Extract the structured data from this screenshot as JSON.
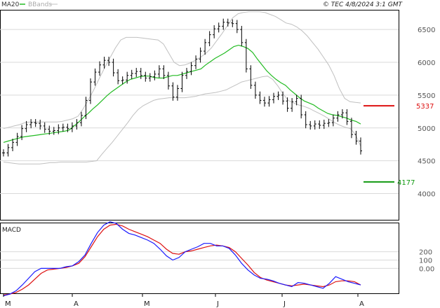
{
  "header": {
    "ma_label": "MA20",
    "bb_label": "BBands",
    "copyright": "© TEC 4/8/2024 3:1 GMT"
  },
  "colors": {
    "price": "#000000",
    "ma": "#22bb22",
    "bbands": "#c0c0c0",
    "macd": "#1a1aff",
    "signal": "#dd1111",
    "resistance": "#dd1111",
    "support": "#119911",
    "grid": "#d9d9d9"
  },
  "chart_data": [
    {
      "type": "candlestick",
      "name": "price",
      "title": "",
      "ylim": [
        3600,
        6800
      ],
      "y_ticks": [
        4000,
        4500,
        5000,
        5500,
        6000,
        6500
      ],
      "x_ticks": [
        "M",
        "A",
        "M",
        "J",
        "J",
        "A"
      ],
      "grid": true,
      "price": [
        4620,
        4700,
        4780,
        4870,
        4990,
        5050,
        5080,
        5070,
        5030,
        4980,
        4950,
        4960,
        5000,
        5010,
        4990,
        5030,
        5080,
        5190,
        5420,
        5700,
        5850,
        5960,
        6030,
        6000,
        5840,
        5720,
        5730,
        5800,
        5830,
        5860,
        5800,
        5760,
        5780,
        5820,
        5900,
        5800,
        5640,
        5470,
        5600,
        5800,
        5860,
        5950,
        6050,
        6170,
        6300,
        6420,
        6510,
        6550,
        6610,
        6600,
        6590,
        6500,
        6300,
        5900,
        5650,
        5500,
        5420,
        5380,
        5430,
        5480,
        5500,
        5410,
        5300,
        5400,
        5450,
        5200,
        5050,
        5030,
        5060,
        5040,
        5070,
        5080,
        5150,
        5200,
        5230,
        5100,
        4900,
        4800,
        4650
      ],
      "ma20": [
        4780,
        4800,
        4820,
        4840,
        4860,
        4870,
        4880,
        4890,
        4900,
        4910,
        4920,
        4930,
        4940,
        4950,
        4970,
        5030,
        5090,
        5160,
        5220,
        5290,
        5350,
        5420,
        5490,
        5550,
        5600,
        5650,
        5700,
        5740,
        5760,
        5780,
        5790,
        5790,
        5770,
        5760,
        5760,
        5780,
        5800,
        5800,
        5820,
        5840,
        5860,
        5880,
        5900,
        5960,
        6010,
        6060,
        6100,
        6140,
        6190,
        6240,
        6260,
        6240,
        6210,
        6150,
        6050,
        5960,
        5870,
        5800,
        5740,
        5690,
        5650,
        5580,
        5520,
        5460,
        5410,
        5380,
        5350,
        5300,
        5260,
        5220,
        5200,
        5190,
        5170,
        5150,
        5120,
        5100,
        5060
      ],
      "bb_upper": [
        4990,
        5010,
        5030,
        5050,
        5080,
        5090,
        5090,
        5090,
        5090,
        5090,
        5090,
        5100,
        5120,
        5140,
        5180,
        5300,
        5440,
        5590,
        5760,
        5920,
        6070,
        6220,
        6340,
        6380,
        6380,
        6380,
        6370,
        6360,
        6350,
        6340,
        6280,
        6140,
        6000,
        5950,
        5960,
        5990,
        6030,
        6080,
        6140,
        6220,
        6330,
        6440,
        6560,
        6680,
        6740,
        6760,
        6770,
        6770,
        6770,
        6760,
        6730,
        6700,
        6650,
        6600,
        6580,
        6540,
        6480,
        6400,
        6300,
        6200,
        6080,
        5960,
        5800,
        5600,
        5450,
        5400,
        5390,
        5380
      ],
      "bb_lower": [
        4480,
        4470,
        4460,
        4450,
        4450,
        4450,
        4450,
        4450,
        4460,
        4470,
        4470,
        4480,
        4480,
        4480,
        4480,
        4480,
        4480,
        4490,
        4500,
        4600,
        4690,
        4780,
        4880,
        4980,
        5080,
        5190,
        5280,
        5340,
        5380,
        5420,
        5440,
        5450,
        5460,
        5460,
        5460,
        5460,
        5470,
        5480,
        5500,
        5520,
        5530,
        5540,
        5560,
        5580,
        5620,
        5660,
        5700,
        5720,
        5740,
        5760,
        5780,
        5790,
        5740,
        5640,
        5520,
        5420,
        5380,
        5350,
        5330,
        5300,
        5260,
        5220,
        5180,
        5130,
        5080,
        5040,
        5010,
        4990,
        4900,
        4720
      ]
    },
    {
      "type": "line",
      "name": "MACD",
      "title": "MACD",
      "ylim": [
        -300,
        550
      ],
      "y_ticks": [
        0,
        100,
        200
      ],
      "y_tick_labels": [
        "0.00",
        "100",
        "200"
      ],
      "series": [
        {
          "name": "macd",
          "values": [
            -330,
            -310,
            -270,
            -200,
            -120,
            -40,
            0,
            0,
            0,
            0,
            20,
            30,
            80,
            160,
            300,
            430,
            520,
            560,
            540,
            470,
            420,
            400,
            370,
            340,
            300,
            230,
            150,
            100,
            130,
            200,
            230,
            260,
            300,
            300,
            270,
            270,
            240,
            160,
            60,
            -20,
            -80,
            -120,
            -130,
            -150,
            -180,
            -200,
            -220,
            -170,
            -180,
            -200,
            -220,
            -240,
            -180,
            -100,
            -130,
            -160,
            -180,
            -200
          ]
        },
        {
          "name": "signal",
          "values": [
            -320,
            -310,
            -290,
            -250,
            -200,
            -130,
            -60,
            -20,
            -10,
            0,
            10,
            30,
            60,
            140,
            260,
            380,
            470,
            520,
            530,
            510,
            470,
            440,
            410,
            380,
            340,
            300,
            230,
            180,
            170,
            200,
            210,
            230,
            250,
            270,
            280,
            270,
            250,
            200,
            120,
            40,
            -50,
            -110,
            -140,
            -160,
            -180,
            -200,
            -210,
            -200,
            -190,
            -200,
            -210,
            -220,
            -200,
            -160,
            -150,
            -150,
            -160,
            -200
          ]
        }
      ]
    }
  ],
  "levels": {
    "resistance": {
      "value": 5337,
      "label": "5337"
    },
    "support": {
      "value": 4177,
      "label": "4177"
    }
  }
}
